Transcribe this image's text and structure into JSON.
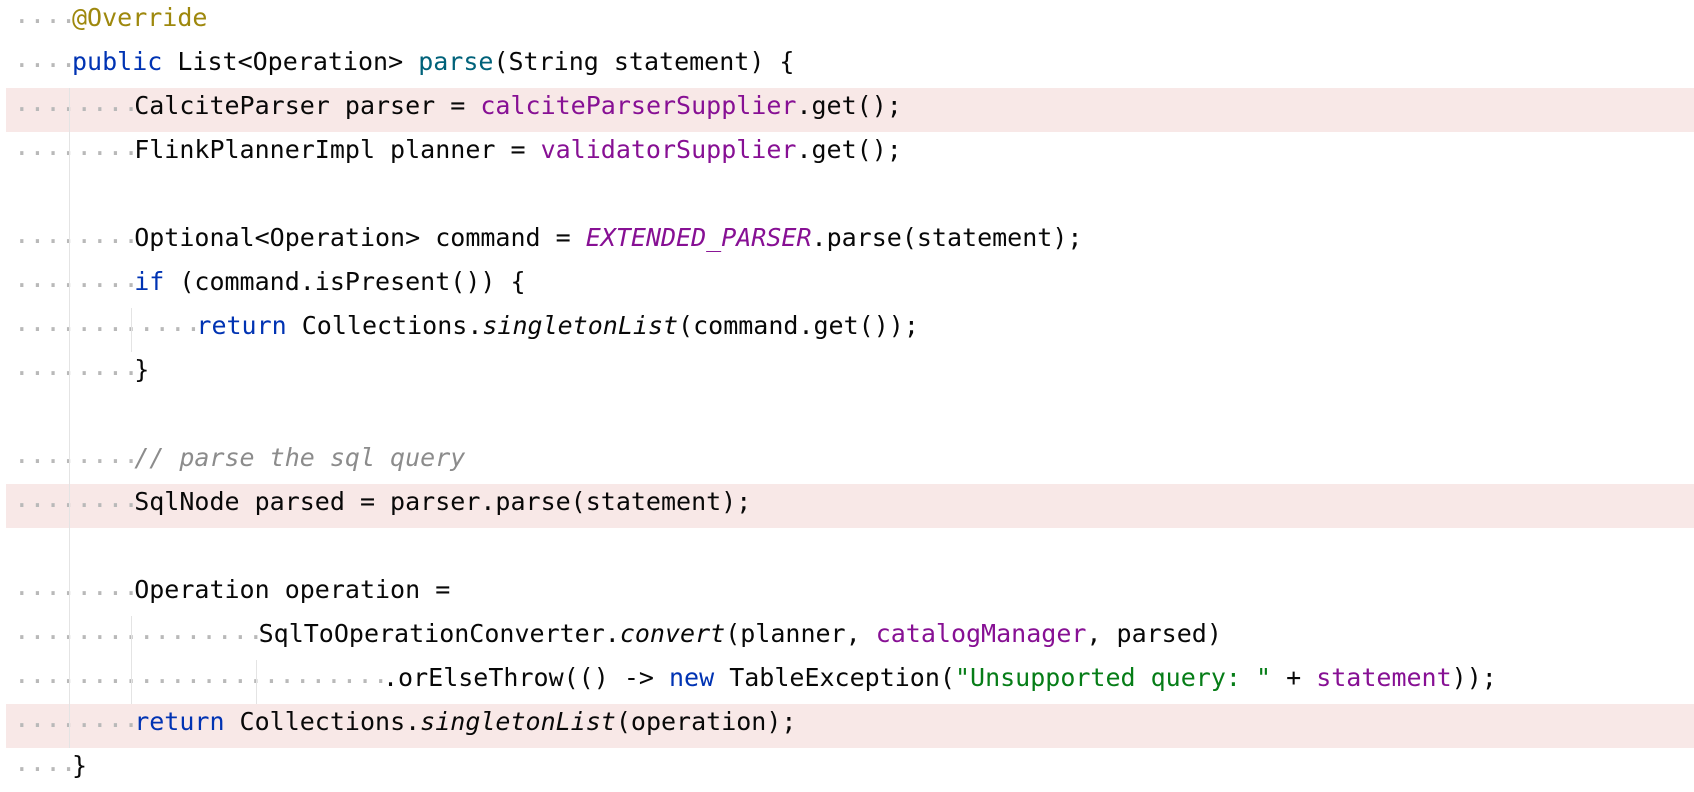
{
  "editor": {
    "lines": [
      {
        "indent": 1,
        "highlight": false,
        "tokens": [
          {
            "t": "@Override",
            "c": "ann"
          }
        ]
      },
      {
        "indent": 1,
        "highlight": false,
        "tokens": [
          {
            "t": "public",
            "c": "kw"
          },
          {
            "t": " List<Operation> ",
            "c": ""
          },
          {
            "t": "parse",
            "c": "fn"
          },
          {
            "t": "(String statement) {",
            "c": ""
          }
        ]
      },
      {
        "indent": 2,
        "highlight": true,
        "tokens": [
          {
            "t": "CalciteParser parser = ",
            "c": ""
          },
          {
            "t": "calciteParserSupplier",
            "c": "fld"
          },
          {
            "t": ".get();",
            "c": ""
          }
        ]
      },
      {
        "indent": 2,
        "highlight": false,
        "tokens": [
          {
            "t": "FlinkPlannerImpl planner = ",
            "c": ""
          },
          {
            "t": "validatorSupplier",
            "c": "fld"
          },
          {
            "t": ".get();",
            "c": ""
          }
        ]
      },
      {
        "indent": 0,
        "highlight": false,
        "tokens": []
      },
      {
        "indent": 2,
        "highlight": false,
        "tokens": [
          {
            "t": "Optional<Operation> command = ",
            "c": ""
          },
          {
            "t": "EXTENDED_PARSER",
            "c": "cst"
          },
          {
            "t": ".parse(statement);",
            "c": ""
          }
        ]
      },
      {
        "indent": 2,
        "highlight": false,
        "tokens": [
          {
            "t": "if",
            "c": "kw"
          },
          {
            "t": " (command.isPresent()) {",
            "c": ""
          }
        ]
      },
      {
        "indent": 3,
        "highlight": false,
        "tokens": [
          {
            "t": "return",
            "c": "kw"
          },
          {
            "t": " Collections.",
            "c": ""
          },
          {
            "t": "singletonList",
            "c": "itl"
          },
          {
            "t": "(command.get());",
            "c": ""
          }
        ]
      },
      {
        "indent": 2,
        "highlight": false,
        "tokens": [
          {
            "t": "}",
            "c": ""
          }
        ]
      },
      {
        "indent": 0,
        "highlight": false,
        "tokens": []
      },
      {
        "indent": 2,
        "highlight": false,
        "tokens": [
          {
            "t": "// parse the sql query",
            "c": "cmt"
          }
        ]
      },
      {
        "indent": 2,
        "highlight": true,
        "tokens": [
          {
            "t": "SqlNode parsed = parser.parse(statement);",
            "c": ""
          }
        ]
      },
      {
        "indent": 0,
        "highlight": false,
        "tokens": []
      },
      {
        "indent": 2,
        "highlight": false,
        "tokens": [
          {
            "t": "Operation operation =",
            "c": ""
          }
        ]
      },
      {
        "indent": 4,
        "highlight": false,
        "tokens": [
          {
            "t": "SqlToOperationConverter.",
            "c": ""
          },
          {
            "t": "convert",
            "c": "itl"
          },
          {
            "t": "(planner, ",
            "c": ""
          },
          {
            "t": "catalogManager",
            "c": "fld"
          },
          {
            "t": ", parsed)",
            "c": ""
          }
        ]
      },
      {
        "indent": 6,
        "highlight": false,
        "tokens": [
          {
            "t": ".orElseThrow(() -> ",
            "c": ""
          },
          {
            "t": "new",
            "c": "kw"
          },
          {
            "t": " TableException(",
            "c": ""
          },
          {
            "t": "\"Unsupported query: \"",
            "c": "str"
          },
          {
            "t": " + ",
            "c": ""
          },
          {
            "t": "statement",
            "c": "fld"
          },
          {
            "t": "));",
            "c": ""
          }
        ]
      },
      {
        "indent": 2,
        "highlight": true,
        "tokens": [
          {
            "t": "return",
            "c": "kw"
          },
          {
            "t": " Collections.",
            "c": ""
          },
          {
            "t": "singletonList",
            "c": "itl"
          },
          {
            "t": "(operation);",
            "c": ""
          }
        ]
      },
      {
        "indent": 1,
        "highlight": false,
        "tokens": [
          {
            "t": "}",
            "c": ""
          }
        ]
      }
    ],
    "colors": {
      "keyword": "#0033b3",
      "annotation": "#9e880d",
      "method_decl": "#00627a",
      "field": "#871094",
      "string": "#067d17",
      "comment": "#8c8c8c",
      "highlight_bg": "#f8e8e7"
    }
  }
}
